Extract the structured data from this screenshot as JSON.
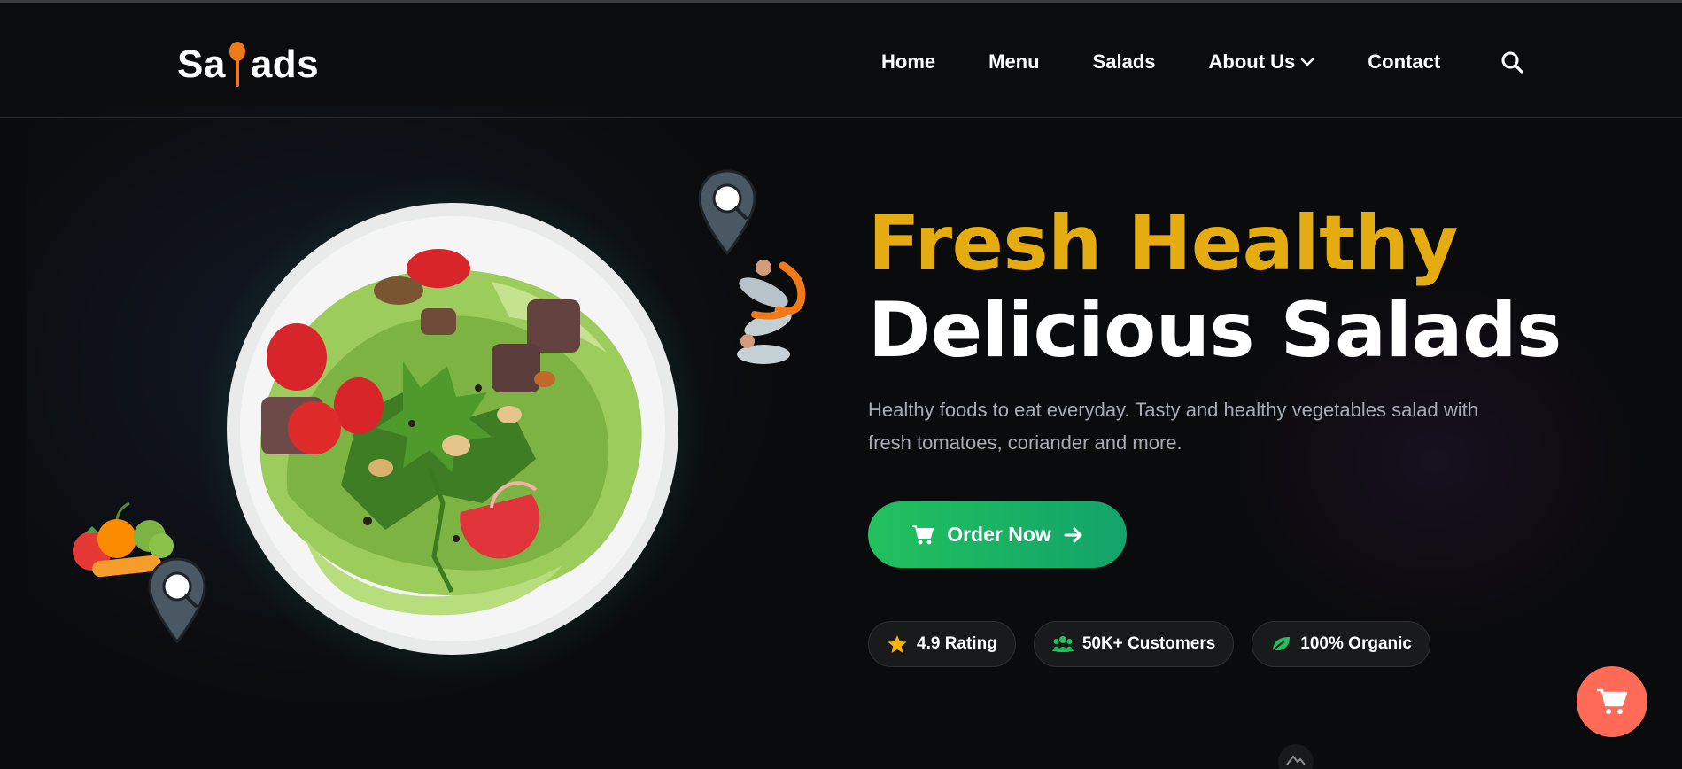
{
  "logo": {
    "prefix": "Sa",
    "suffix": "ads"
  },
  "nav": {
    "items": [
      {
        "label": "Home"
      },
      {
        "label": "Menu"
      },
      {
        "label": "Salads"
      },
      {
        "label": "About Us",
        "has_dropdown": true
      },
      {
        "label": "Contact"
      }
    ],
    "search_icon": "search-icon"
  },
  "hero": {
    "title_line1": "Fresh Healthy",
    "title_line2": "Delicious Salads",
    "description": "Healthy foods to eat everyday. Tasty and healthy vegetables salad with fresh tomatoes, coriander and more.",
    "order_button": {
      "label": "Order Now",
      "icon_left": "cart-icon",
      "icon_right": "arrow-right-icon"
    },
    "badges": [
      {
        "label": "4.9 Rating",
        "icon": "star-icon"
      },
      {
        "label": "50K+ Customers",
        "icon": "users-icon"
      },
      {
        "label": "100% Organic",
        "icon": "leaf-icon"
      }
    ]
  },
  "colors": {
    "accent_gold": "#e5ac12",
    "button_green": "#22c15e",
    "cart_fab": "#ff6b57",
    "background": "#0a0b0c"
  },
  "floating_cart_icon": "cart-icon"
}
